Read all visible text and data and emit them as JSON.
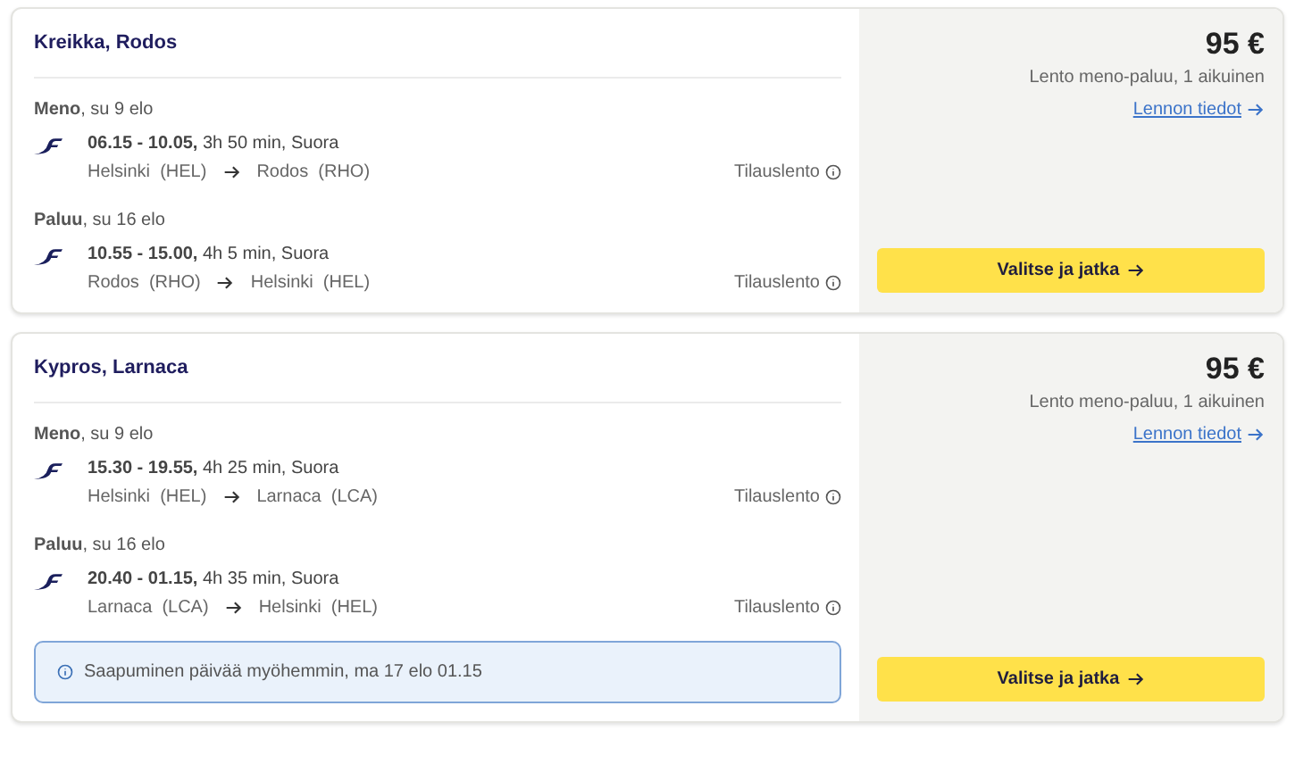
{
  "offers": [
    {
      "destination": "Kreikka, Rodos",
      "segments": [
        {
          "heading": "**Meno**, su 9 elo",
          "times": "**06.15 - 10.05,** 3h 50 min, Suora",
          "from": "Helsinki  (HEL)",
          "to": "Rodos  (RHO)",
          "type": "Tilauslento"
        },
        {
          "heading": "**Paluu**, su 16 elo",
          "times": "**10.55 - 15.00,** 4h 5 min, Suora",
          "from": "Rodos  (RHO)",
          "to": "Helsinki  (HEL)",
          "type": "Tilauslento"
        }
      ],
      "price": "95 €",
      "price_note": "Lento meno-paluu, 1 aikuinen",
      "details_link": "Lennon tiedot",
      "button": "Valitse ja jatka"
    },
    {
      "destination": "Kypros, Larnaca",
      "segments": [
        {
          "heading": "**Meno**, su 9 elo",
          "times": "**15.30 - 19.55,** 4h 25 min, Suora",
          "from": "Helsinki  (HEL)",
          "to": "Larnaca  (LCA)",
          "type": "Tilauslento"
        },
        {
          "heading": "**Paluu**, su 16 elo",
          "times": "**20.40 - 01.15,** 4h 35 min, Suora",
          "from": "Larnaca  (LCA)",
          "to": "Helsinki  (HEL)",
          "type": "Tilauslento"
        }
      ],
      "notice": "Saapuminen päivää myöhemmin, ma 17 elo 01.15",
      "price": "95 €",
      "price_note": "Lento meno-paluu, 1 aikuinen",
      "details_link": "Lennon tiedot",
      "button": "Valitse ja jatka"
    }
  ]
}
